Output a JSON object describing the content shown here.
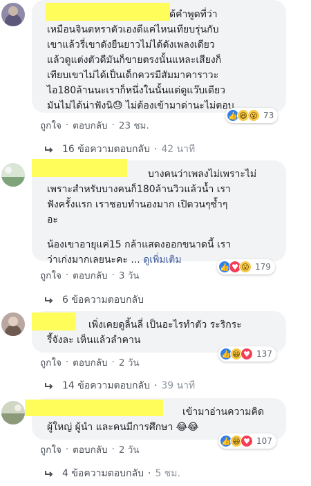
{
  "comments": [
    {
      "lines": [
        "ได้คำพูดที่ว่า",
        "เหมือนจินตหราตัวเองดีแค่ไหนเทียบรุ่นกับ",
        "เขาแล้วรี่เขาดังยืนยาวไม่ได้ดังเพลงเดียว",
        "แล้วดูแต่งตัวดีมันก็ขายตรงนั้นแหละเสียงก็",
        "เทียบเขาไม่ได้เป็นเด็กควรมีสัมมาคาราวะ",
        "ไอ180ล้านนะเราก็หนึ่งในนั้นแต่ดูแว๊บเดียว",
        "มันไม่ได้น่าฟังนิ😓 ไม่ต้องเข้ามาด่านะไม่ตอบ"
      ],
      "reaction_count": "73",
      "like_label": "ถูกใจ",
      "reply_label": "ตอบกลับ",
      "time": "23 ชม.",
      "replies_text": "16 ข้อความตอบกลับ",
      "replies_time": "42 นาที"
    },
    {
      "para1": [
        "บางคนว่าเพลงไม่เพราะไม่",
        "เพราะสำหรับบางคนก็180ล้านวิวแล้วน้ำ เรา",
        "ฟังครั้งแรก เราชอบทำนองมาก เปิดวนๆซ้ำๆ",
        "อะ"
      ],
      "para2_line1": "น้องเขาอายุแค่15 กล้าแสดงออกขนาดนี้ เรา",
      "para2_line2": "ว่าเก่งมากเลยนะคะ ... ",
      "see_more": "ดูเพิ่มเติม",
      "reaction_count": "179",
      "like_label": "ถูกใจ",
      "reply_label": "ตอบกลับ",
      "time": "3 วัน",
      "replies_text": "6 ข้อความตอบกลับ"
    },
    {
      "lines": [
        "เพิ่งเคยดูลิ้นลี่ เป็นอะไรทำตัว ระริกระ",
        "รี้จังละ เห็นแล้วลำคาน"
      ],
      "reaction_count": "137",
      "like_label": "ถูกใจ",
      "reply_label": "ตอบกลับ",
      "time": "2 วัน",
      "replies_text": "14 ข้อความตอบกลับ",
      "replies_time": "39 นาที"
    },
    {
      "lines": [
        "เข้ามาอ่านความคิด",
        "ผู้ใหญ่ ผู้นำ และคนมีการศึกษา 😂😂"
      ],
      "reaction_count": "107",
      "like_label": "ถูกใจ",
      "reply_label": "ตอบกลับ",
      "time": "2 วัน",
      "replies_text": "4 ข้อความตอบกลับ",
      "replies_time": "5 ชม."
    }
  ],
  "colors": {
    "redaction": "#fffd5a",
    "bubble": "#f2f3f5",
    "link": "#385898",
    "like": "#2f80ed",
    "love": "#f33e58"
  },
  "icons": [
    "like-reaction-icon",
    "haha-reaction-icon",
    "wow-reaction-icon",
    "love-reaction-icon",
    "reply-arrow-icon"
  ]
}
